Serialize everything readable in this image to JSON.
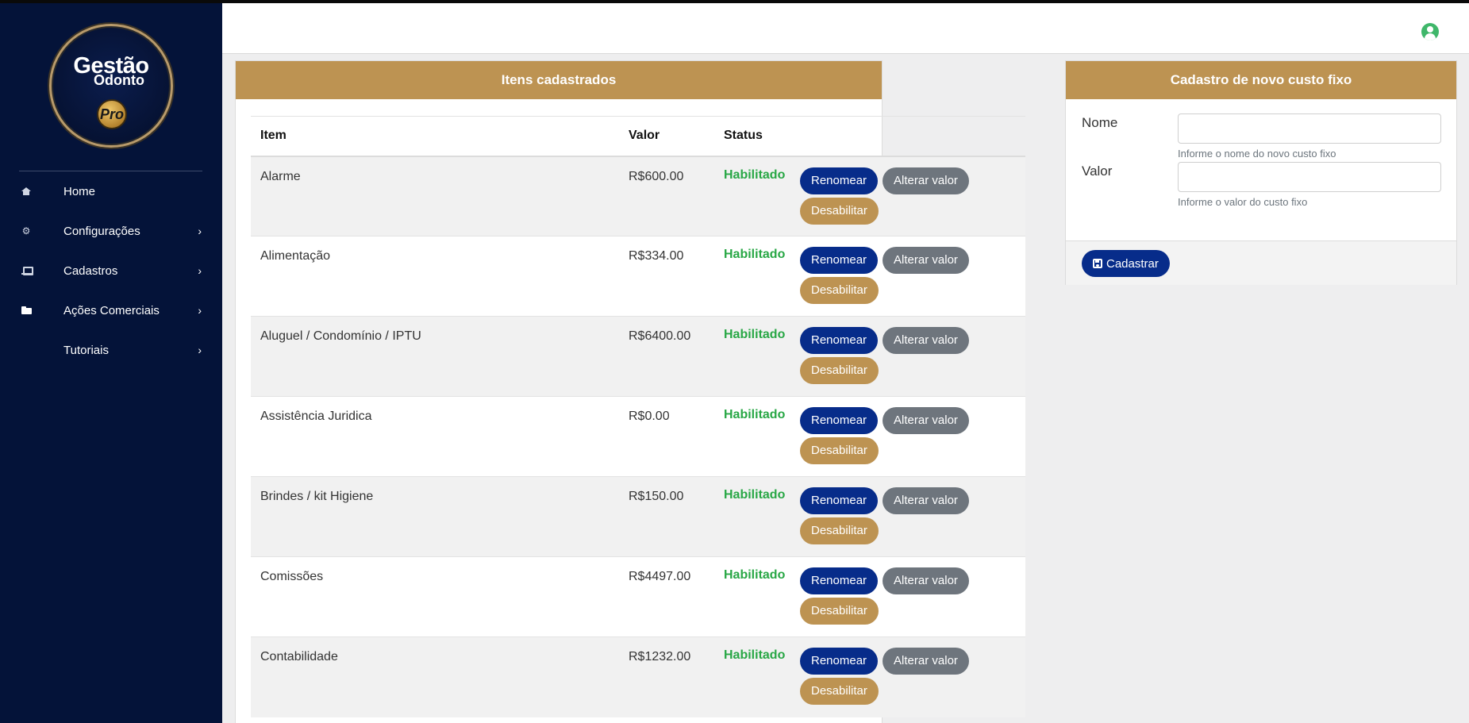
{
  "logo": {
    "line1": "Gestão",
    "line2": "Odonto",
    "badge": "Pro"
  },
  "sidebar": {
    "items": [
      {
        "label": "Home",
        "icon": "home-icon",
        "has_chevron": false
      },
      {
        "label": "Configurações",
        "icon": "gear-icon",
        "has_chevron": true
      },
      {
        "label": "Cadastros",
        "icon": "laptop-icon",
        "has_chevron": true
      },
      {
        "label": "Ações Comerciais",
        "icon": "folder-icon",
        "has_chevron": true
      },
      {
        "label": "Tutoriais",
        "icon": "",
        "has_chevron": true
      }
    ],
    "chevron": "›"
  },
  "header": {
    "user_icon": "user-circle-icon",
    "user_icon_color": "#3fb76a"
  },
  "list_card": {
    "title": "Itens cadastrados",
    "columns": [
      "Item",
      "Valor",
      "Status",
      ""
    ],
    "rows": [
      {
        "item": "Alarme",
        "valor": "R$600.00",
        "status": "Habilitado"
      },
      {
        "item": "Alimentação",
        "valor": "R$334.00",
        "status": "Habilitado"
      },
      {
        "item": "Aluguel / Condomínio / IPTU",
        "valor": "R$6400.00",
        "status": "Habilitado"
      },
      {
        "item": "Assistência Juridica",
        "valor": "R$0.00",
        "status": "Habilitado"
      },
      {
        "item": "Brindes / kit Higiene",
        "valor": "R$150.00",
        "status": "Habilitado"
      },
      {
        "item": "Comissões",
        "valor": "R$4497.00",
        "status": "Habilitado"
      },
      {
        "item": "Contabilidade",
        "valor": "R$1232.00",
        "status": "Habilitado"
      }
    ],
    "actions": {
      "rename": "Renomear",
      "change_value": "Alterar valor",
      "disable": "Desabilitar"
    }
  },
  "form_card": {
    "title": "Cadastro de novo custo fixo",
    "name_label": "Nome",
    "name_value": "",
    "name_help": "Informe o nome do novo custo fixo",
    "value_label": "Valor",
    "value_value": "",
    "value_help": "Informe o valor do custo fixo",
    "submit_label": "Cadastrar",
    "submit_icon": "floppy-disk-icon"
  },
  "colors": {
    "sidebar_bg": "#041339",
    "card_header": "#bd9352",
    "primary_button": "#072c8a",
    "secondary_button": "#6e757d",
    "status_enabled": "#28a745"
  }
}
